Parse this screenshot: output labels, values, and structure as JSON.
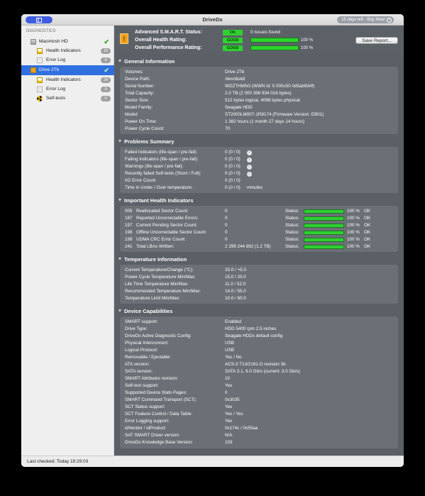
{
  "window": {
    "title": "DriveDx",
    "trial_label": "15 days left - Buy Now!"
  },
  "sidebar": {
    "heading": "DIAGNOSTICS",
    "items": [
      {
        "label": "Macintosh HD",
        "icon": "hard-drive-icon",
        "badge": "",
        "check": "✔"
      },
      {
        "label": "Health Indicators",
        "icon": "health-indicators-icon",
        "badge": "15"
      },
      {
        "label": "Error Log",
        "icon": "error-log-icon",
        "badge": "0"
      },
      {
        "label": "Drive 2Tb",
        "icon": "drive-icon",
        "badge": "",
        "check": "✔",
        "selected": true
      },
      {
        "label": "Health Indicators",
        "icon": "health-indicators-icon",
        "badge": "24"
      },
      {
        "label": "Error Log",
        "icon": "error-log-icon",
        "badge": "0"
      },
      {
        "label": "Self-tests",
        "icon": "self-tests-icon",
        "badge": "0"
      }
    ]
  },
  "status_bar": {
    "text": "Last checked: Today 19:29:03"
  },
  "summary": {
    "smart_label": "Advanced S.M.A.R.T. Status:",
    "smart_value": "OK",
    "issues": "0 issues found",
    "health_label": "Overall Health Rating:",
    "health_value": "GOOD",
    "health_pct": "100 %",
    "health_level": 1.0,
    "perf_label": "Overall Performance Rating:",
    "perf_value": "GOOD",
    "perf_pct": "100 %",
    "perf_level": 1.0,
    "save_report": "Save Report..."
  },
  "general": {
    "title": "General Information",
    "rows": [
      {
        "k": "Volumes:",
        "v": "Drive 2Tb"
      },
      {
        "k": "Device Path:",
        "v": "/dev/disk8"
      },
      {
        "k": "Serial Number:",
        "v": "WDZTHMN3 (WWN Id: 5 000c50 0d5ab934f)"
      },
      {
        "k": "Total Capacity:",
        "v": "2.0 TB (2 000 398 934 016 bytes)"
      },
      {
        "k": "Sector Size:",
        "v": "512 bytes logical, 4096 bytes physical"
      },
      {
        "k": "Model Family:",
        "v": "Seagate HDD"
      },
      {
        "k": "Model:",
        "v": "ST2000LM007-1R8174  (Firmware Version: EB01)"
      },
      {
        "k": "Power On Time:",
        "v": "1 382 hours (1 month 27 days 14 hours)"
      },
      {
        "k": "Power Cycle Count:",
        "v": "70"
      }
    ]
  },
  "problems": {
    "title": "Problems Summary",
    "rows": [
      {
        "k": "Failed Indicators (life-span / pre-fail):",
        "v": "0 (0 / 0)",
        "arrow": "›"
      },
      {
        "k": "Failing Indicators (life-span / pre-fail):",
        "v": "0 (0 / 0)",
        "arrow": "›"
      },
      {
        "k": "Warnings (life-span / pre-fail):",
        "v": "0 (0 / 0)",
        "arrow": "›"
      },
      {
        "k": "Recently failed Self-tests (Short / Full):",
        "v": "0 (0 / 0)",
        "arrow": "›"
      },
      {
        "k": "I/O Error Count:",
        "v": "0 (0 / 0)"
      },
      {
        "k": "Time in Under / Over temperature:",
        "v": "0 (0 / 0)",
        "v2": "minutes"
      }
    ]
  },
  "indicators": {
    "title": "Important Health Indicators",
    "status_label": "Status:",
    "rows": [
      {
        "num": "005",
        "name": "Reallocated Sector Count:",
        "value": "0",
        "level": 1.0,
        "pct": "100 %",
        "ok": "OK"
      },
      {
        "num": "187",
        "name": "Reported Uncorrectable Errors:",
        "value": "0",
        "level": 1.0,
        "pct": "100 %",
        "ok": "OK"
      },
      {
        "num": "197",
        "name": "Current Pending Sector Count:",
        "value": "0",
        "level": 1.0,
        "pct": "100 %",
        "ok": "OK"
      },
      {
        "num": "198",
        "name": "Offline Uncorrectable Sector Count:",
        "value": "0",
        "level": 1.0,
        "pct": "100 %",
        "ok": "OK"
      },
      {
        "num": "199",
        "name": "UDMA CRC Error Count:",
        "value": "0",
        "level": 1.0,
        "pct": "100 %",
        "ok": "OK"
      },
      {
        "num": "241",
        "name": "Total LBAs Written:",
        "value": "2 299 244 892 (1.2 TB)",
        "level": 1.0,
        "pct": "100 %",
        "ok": "OK"
      }
    ]
  },
  "temperature": {
    "title": "Temperature Information",
    "rows": [
      {
        "k": "Current Temperature/Change (°C):",
        "v": "20.0 / +5.0"
      },
      {
        "k": "Power Cycle Temperature Min/Max:",
        "v": "15.0 / 20.0"
      },
      {
        "k": "Life Time Temperature Min/Max:",
        "v": "11.0 / 52.0"
      },
      {
        "k": "Recommended Temperature Min/Max:",
        "v": "14.0 / 55.0"
      },
      {
        "k": "Temperature Limit Min/Max:",
        "v": "10.0 / 60.0"
      }
    ]
  },
  "capabilities": {
    "title": "Device Capabilities",
    "rows": [
      {
        "k": "SMART support:",
        "v": "Enabled"
      },
      {
        "k": "Drive Type:",
        "v": "HDD 5400 rpm 2.5 inches"
      },
      {
        "k": "DriveDx Active Diagnostic Config:",
        "v": "Seagate HDDs default config"
      },
      {
        "k": "Physical Interconnect:",
        "v": "USB"
      },
      {
        "k": "Logical Protocol:",
        "v": "USB"
      },
      {
        "k": "Removable / Ejectable:",
        "v": "Yes / No"
      },
      {
        "k": "ATA version:",
        "v": "ACS-3 T13/2161-D revision 3b"
      },
      {
        "k": "SATA version:",
        "v": "SATA 3.1, 6.0 Gb/s (current: 3.0 Gb/s)"
      },
      {
        "k": "SMART Attributes revision:",
        "v": "10"
      },
      {
        "k": "Self-test support:",
        "v": "Yes"
      },
      {
        "k": "Supported Device Stats Pages:",
        "v": "0"
      },
      {
        "k": "SMART Command Transport (SCT):",
        "v": "0x3035"
      },
      {
        "k": "SCT Status support:",
        "v": "Yes"
      },
      {
        "k": "SCT Feature Control / Data Table:",
        "v": "Yes / Yes"
      },
      {
        "k": "Error Logging support:",
        "v": "Yes"
      },
      {
        "k": "idVendor / idProduct:",
        "v": "0x174c / 0x55aa"
      },
      {
        "k": "SAT SMART Driver version:",
        "v": "N/A"
      },
      {
        "k": "DriveDx Knowledge Base Version:",
        "v": "103"
      }
    ]
  },
  "colors": {
    "accent": "#2f6fe0",
    "good": "#2fd130",
    "panel": "#6a7076",
    "background": "#5a6066"
  }
}
